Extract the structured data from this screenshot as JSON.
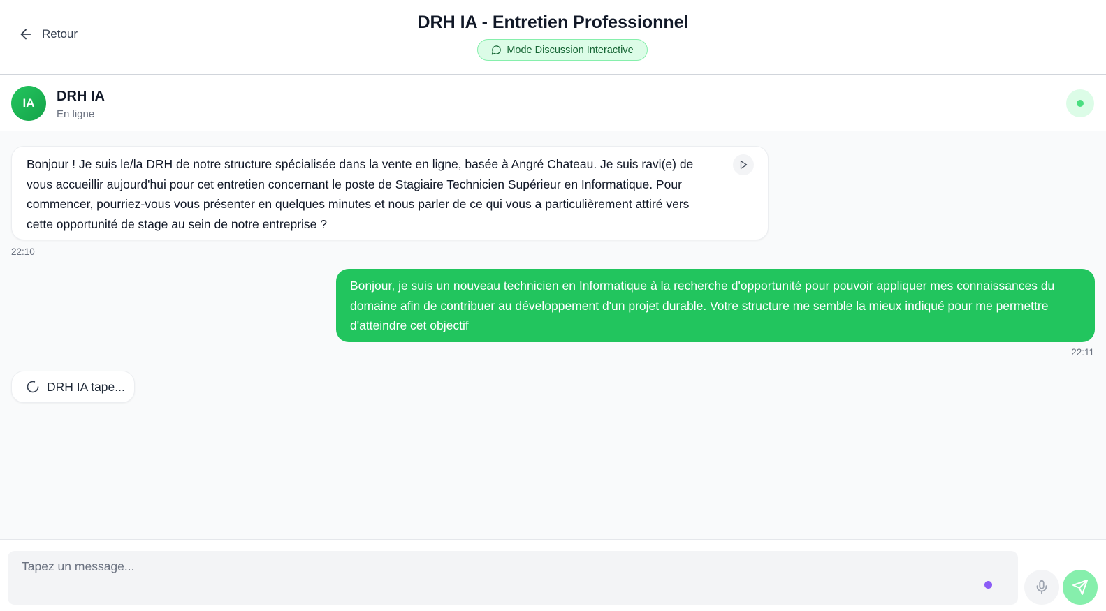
{
  "header": {
    "back_label": "Retour",
    "title": "DRH IA - Entretien Professionnel",
    "mode_badge": "Mode Discussion Interactive"
  },
  "contact": {
    "avatar_initials": "IA",
    "name": "DRH IA",
    "status": "En ligne"
  },
  "messages": [
    {
      "sender": "ai",
      "text": "Bonjour ! Je suis le/la DRH de notre structure spécialisée dans la vente en ligne, basée à Angré Chateau. Je suis ravi(e) de vous accueillir aujourd'hui pour cet entretien concernant le poste de Stagiaire Technicien Supérieur en Informatique. Pour commencer, pourriez-vous vous présenter en quelques minutes et nous parler de ce qui vous a particulièrement attiré vers cette opportunité de stage au sein de notre entreprise ?",
      "time": "22:10"
    },
    {
      "sender": "user",
      "text": "Bonjour, je suis un nouveau technicien en Informatique à la recherche d'opportunité pour pouvoir appliquer mes connaissances du domaine afin de contribuer au développement d'un projet durable. Votre structure me semble la mieux indiqué pour me permettre d'atteindre cet objectif",
      "time": "22:11"
    }
  ],
  "typing_indicator": "DRH IA tape...",
  "composer": {
    "placeholder": "Tapez un message...",
    "value": ""
  },
  "icons": {
    "back": "arrow-left-icon",
    "badge": "message-circle-icon",
    "play": "play-icon",
    "typing": "loader-icon",
    "mic": "microphone-icon",
    "send": "send-icon"
  },
  "colors": {
    "accent": "#22c55e",
    "badge_bg": "#dcfce7",
    "send_disabled": "#86efac",
    "input_dot": "#8b5cf6"
  }
}
